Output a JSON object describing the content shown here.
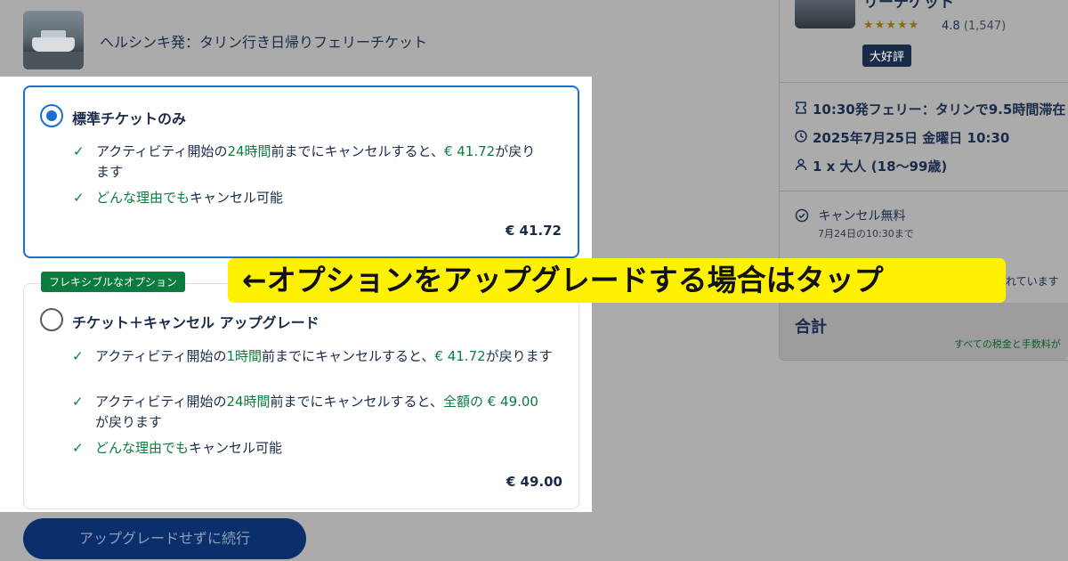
{
  "header": {
    "title": "ヘルシンキ発：タリン行き日帰りフェリーチケット"
  },
  "options": [
    {
      "title": "標準チケットのみ",
      "selected": true,
      "features": [
        {
          "parts": [
            "アクティビティ開始の",
            "24時間",
            "前までにキャンセルすると、",
            "€ 41.72",
            "が戻ります"
          ]
        },
        {
          "parts": [
            "どんな理由でも",
            "キャンセル可能"
          ]
        }
      ],
      "price": "€ 41.72"
    },
    {
      "badge": "フレキシブルなオプション",
      "title": "チケット＋キャンセル アップグレード",
      "selected": false,
      "features": [
        {
          "parts": [
            "アクティビティ開始の",
            "1時間",
            "前までにキャンセルすると、",
            "€ 41.72",
            "が戻ります"
          ]
        },
        {
          "parts": [
            "アクティビティ開始の",
            "24時間",
            "前までにキャンセルすると、",
            "全額の € 49.00",
            " が戻ります"
          ]
        },
        {
          "parts": [
            "どんな理由でも",
            "キャンセル可能"
          ]
        }
      ],
      "price": "€ 49.00"
    }
  ],
  "continue_button": "アップグレードせずに続行",
  "summary": {
    "title": "リーチケット",
    "stars": "★★★★★",
    "rating": "4.8",
    "rating_count": "(1,547)",
    "badge": "大好評",
    "departure": "10:30発フェリー：タリンで9.5時間滞在",
    "date": "2025年7月25日 金曜日 10:30",
    "travelers": "1 x 大人 (18〜99歳)",
    "cancel_title": "キャンセル無料",
    "cancel_deadline": "7月24日の10:30まで",
    "included_fragment": "れています",
    "total_label": "合計",
    "total_note": "すべての税金と手数料が"
  },
  "annotation": "←オプションをアップグレードする場合はタップ",
  "colors": {
    "accent_blue": "#1a6fd3",
    "green": "#0a7d3e",
    "navy": "#1a2b49",
    "highlight_yellow": "#fff200"
  },
  "icons": {
    "check": "check-icon",
    "ticket": "ticket-icon",
    "clock": "clock-icon",
    "person": "person-icon",
    "cancel_ok": "check-circle-icon"
  }
}
